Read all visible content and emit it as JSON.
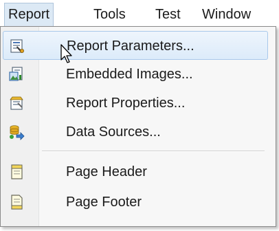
{
  "menubar": {
    "items": [
      {
        "label": "Report"
      },
      {
        "label": "Tools"
      },
      {
        "label": "Test"
      },
      {
        "label": "Window"
      }
    ]
  },
  "dropdown": {
    "items": [
      {
        "label": "Report Parameters...",
        "icon": "report-parameters-icon"
      },
      {
        "label": "Embedded Images...",
        "icon": "embedded-images-icon"
      },
      {
        "label": "Report Properties...",
        "icon": "report-properties-icon"
      },
      {
        "label": "Data Sources...",
        "icon": "data-sources-icon"
      },
      {
        "label": "Page Header",
        "icon": "page-header-icon"
      },
      {
        "label": "Page Footer",
        "icon": "page-footer-icon"
      }
    ]
  }
}
